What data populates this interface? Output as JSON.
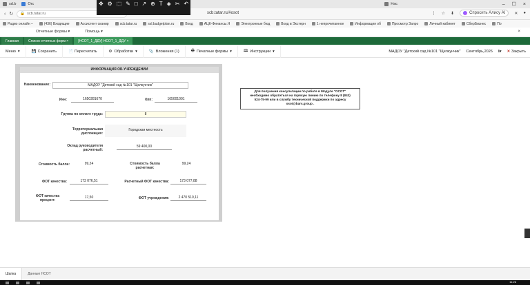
{
  "browser": {
    "tabs": [
      "sd.b",
      "Orc",
      "Нас"
    ],
    "window_close": "×",
    "url": "scb.tatar.ru",
    "page_title": "scb.tatar.ru/#osot",
    "alice_label": "Спросить Алису AI",
    "recorder_icons": [
      "move-icon",
      "settings-icon",
      "select-icon",
      "pen-icon",
      "square-icon",
      "arrow-icon",
      "zoom-icon",
      "text-icon",
      "eraser-icon",
      "scissors-icon",
      "undo-icon"
    ]
  },
  "bookmarks": [
    "Радио онлайн –",
    "(436) Входящие",
    "Ассистент сканир",
    "scb.tatar.ru",
    "ssl.budgetplan.ru",
    "Вход",
    "АЦК-Финансы.Н",
    "Электронные бюд",
    "Вход в Экстерн",
    "1 непрочитанное",
    "Информация об",
    "Просмотр Запро",
    "Личный кабинет",
    "СберБизнес",
    "По"
  ],
  "appmenu": {
    "items": [
      "Отчетные формы ▾",
      "Помощь ▾"
    ],
    "close": "×"
  },
  "doctabs": [
    {
      "label": "Главная"
    },
    {
      "label": "Список отчетных форм ×"
    },
    {
      "label": "[НСОТ_1_ДДУ] НСОТ_1_ДДУ ×"
    }
  ],
  "toolbar": {
    "menu": "Меню",
    "save": "Сохранить",
    "recalc": "Пересчитать",
    "process": "Обработки",
    "attachments": "Вложения (1)",
    "print": "Печатные формы",
    "instructions": "Инструкции",
    "org": "МАДОУ \"Детский сад №101 \"Щелкунчик\"",
    "period": "Сентябрь,2026",
    "close": "Закрыть"
  },
  "form": {
    "header": "ИНФОРМАЦИЯ ОБ УЧРЕЖДЕНИИ",
    "name_label": "Наименование:",
    "name_value": "МАДОУ \"Детский сад №101 \"Щелкунчик\"",
    "inn_label": "Инн:",
    "inn_value": "1650281670",
    "kpp_label": "Кпп:",
    "kpp_value": "165001001",
    "group_label": "Группа по оплате труда:",
    "group_value": "8",
    "territory_label": "Территориальная дислокация:",
    "territory_value": "Городская местность",
    "salary_label": "Оклад руководителя расчетный:",
    "salary_value": "59 400,00",
    "point_cost_label": "Стоимость балла:",
    "point_cost_value": "99,24",
    "point_calc_label": "Стоимость балла расчетная:",
    "point_calc_value": "99,24",
    "fot_quality_label": "ФОТ качества:",
    "fot_quality_value": "173 076,51",
    "fot_calc_label": "Расчетный ФОТ качества:",
    "fot_calc_value": "173 077,88",
    "fot_percent_label": "ФОТ качества процент:",
    "fot_percent_value": "17,50",
    "fot_org_label": "ФОТ учреждения:",
    "fot_org_value": "2 470 510,11"
  },
  "info": {
    "line1": "Для получения консультации по работе в Модуле \"ОСОТ\"",
    "line2": "необходимо обратиться на горячую линию по телефону 8 (843)",
    "line3": "524-75-99 или в службу технической поддержки по адресу",
    "line4": "osot@bars.group ."
  },
  "sheets": [
    "Шапка",
    "Данные НСОТ"
  ],
  "clock": "11:26"
}
